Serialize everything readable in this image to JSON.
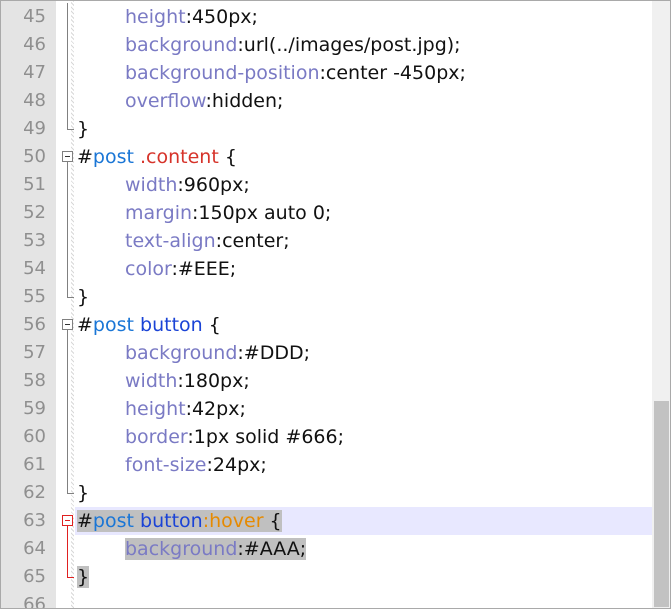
{
  "editor": {
    "lines": [
      {
        "num": "45",
        "indent": true,
        "fold": "line",
        "tokens": [
          {
            "t": "height",
            "c": "t-prop"
          },
          {
            "t": ":450px;",
            "c": "t-val"
          }
        ]
      },
      {
        "num": "46",
        "indent": true,
        "fold": "line",
        "tokens": [
          {
            "t": "background",
            "c": "t-prop"
          },
          {
            "t": ":url(../images/post.jpg);",
            "c": "t-val"
          }
        ]
      },
      {
        "num": "47",
        "indent": true,
        "fold": "line",
        "tokens": [
          {
            "t": "background-position",
            "c": "t-prop"
          },
          {
            "t": ":center -450px;",
            "c": "t-val"
          }
        ]
      },
      {
        "num": "48",
        "indent": true,
        "fold": "line",
        "tokens": [
          {
            "t": "overflow",
            "c": "t-prop"
          },
          {
            "t": ":hidden;",
            "c": "t-val"
          }
        ]
      },
      {
        "num": "49",
        "indent": false,
        "fold": "end",
        "tokens": [
          {
            "t": "}",
            "c": "t-punc"
          }
        ]
      },
      {
        "num": "50",
        "indent": false,
        "fold": "start",
        "tokens": [
          {
            "t": "#",
            "c": "t-id-hash"
          },
          {
            "t": "post",
            "c": "t-id"
          },
          {
            "t": " ",
            "c": "t-punc"
          },
          {
            "t": ".content",
            "c": "t-class"
          },
          {
            "t": " {",
            "c": "t-punc"
          }
        ]
      },
      {
        "num": "51",
        "indent": true,
        "fold": "line",
        "tokens": [
          {
            "t": "width",
            "c": "t-prop"
          },
          {
            "t": ":960px;",
            "c": "t-val"
          }
        ]
      },
      {
        "num": "52",
        "indent": true,
        "fold": "line",
        "tokens": [
          {
            "t": "margin",
            "c": "t-prop"
          },
          {
            "t": ":150px auto 0;",
            "c": "t-val"
          }
        ]
      },
      {
        "num": "53",
        "indent": true,
        "fold": "line",
        "tokens": [
          {
            "t": "text-align",
            "c": "t-prop"
          },
          {
            "t": ":center;",
            "c": "t-val"
          }
        ]
      },
      {
        "num": "54",
        "indent": true,
        "fold": "line",
        "tokens": [
          {
            "t": "color",
            "c": "t-prop"
          },
          {
            "t": ":#EEE;",
            "c": "t-val"
          }
        ]
      },
      {
        "num": "55",
        "indent": false,
        "fold": "end",
        "tokens": [
          {
            "t": "}",
            "c": "t-punc"
          }
        ]
      },
      {
        "num": "56",
        "indent": false,
        "fold": "start",
        "tokens": [
          {
            "t": "#",
            "c": "t-id-hash"
          },
          {
            "t": "post",
            "c": "t-id"
          },
          {
            "t": " ",
            "c": "t-punc"
          },
          {
            "t": "button",
            "c": "t-tag"
          },
          {
            "t": " {",
            "c": "t-punc"
          }
        ]
      },
      {
        "num": "57",
        "indent": true,
        "fold": "line",
        "tokens": [
          {
            "t": "background",
            "c": "t-prop"
          },
          {
            "t": ":#DDD;",
            "c": "t-val"
          }
        ]
      },
      {
        "num": "58",
        "indent": true,
        "fold": "line",
        "tokens": [
          {
            "t": "width",
            "c": "t-prop"
          },
          {
            "t": ":180px;",
            "c": "t-val"
          }
        ]
      },
      {
        "num": "59",
        "indent": true,
        "fold": "line",
        "tokens": [
          {
            "t": "height",
            "c": "t-prop"
          },
          {
            "t": ":42px;",
            "c": "t-val"
          }
        ]
      },
      {
        "num": "60",
        "indent": true,
        "fold": "line",
        "tokens": [
          {
            "t": "border",
            "c": "t-prop"
          },
          {
            "t": ":1px solid #666;",
            "c": "t-val"
          }
        ]
      },
      {
        "num": "61",
        "indent": true,
        "fold": "line",
        "tokens": [
          {
            "t": "font-size",
            "c": "t-prop"
          },
          {
            "t": ":24px;",
            "c": "t-val"
          }
        ]
      },
      {
        "num": "62",
        "indent": false,
        "fold": "end",
        "tokens": [
          {
            "t": "}",
            "c": "t-punc"
          }
        ]
      },
      {
        "num": "63",
        "indent": false,
        "fold": "start-red",
        "current": true,
        "selected": true,
        "tokens": [
          {
            "t": "#",
            "c": "t-id-hash"
          },
          {
            "t": "post",
            "c": "t-id"
          },
          {
            "t": " ",
            "c": "t-punc"
          },
          {
            "t": "button",
            "c": "t-tag"
          },
          {
            "t": ":hover",
            "c": "t-pseudo"
          },
          {
            "t": " {",
            "c": "t-punc"
          }
        ]
      },
      {
        "num": "64",
        "indent": true,
        "fold": "line-red",
        "selected": true,
        "tokens": [
          {
            "t": "background",
            "c": "t-prop"
          },
          {
            "t": ":#AAA;",
            "c": "t-val"
          }
        ]
      },
      {
        "num": "65",
        "indent": false,
        "fold": "end-red",
        "selected": true,
        "tokens": [
          {
            "t": "}",
            "c": "t-punc"
          }
        ]
      },
      {
        "num": "66",
        "indent": false,
        "fold": "none",
        "tokens": []
      }
    ]
  },
  "colors": {
    "gutter_bg": "#e4e4e4",
    "line_number": "#8f8f8f",
    "property": "#7a7ac4",
    "id_selector": "#1a76d6",
    "class_selector": "#d6332a",
    "tag_selector": "#1a43d6",
    "pseudo_class": "#e68a00",
    "selection": "#c0c0c0",
    "current_line": "#e8e8ff"
  }
}
